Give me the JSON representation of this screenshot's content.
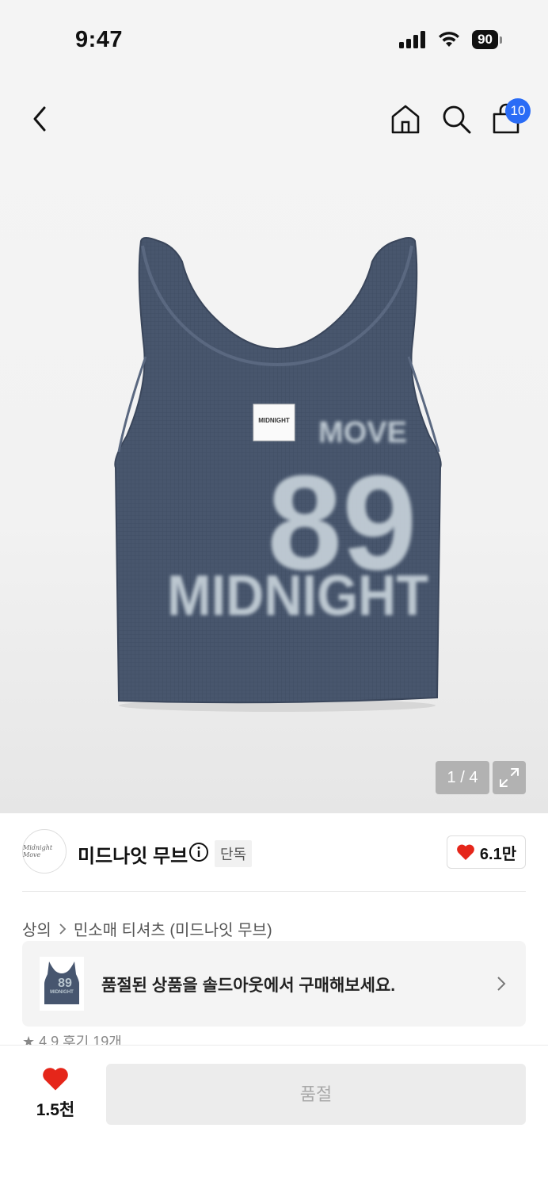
{
  "status": {
    "time": "9:47",
    "battery": "90"
  },
  "nav": {
    "cart_count": "10"
  },
  "product_image": {
    "print_top": "MOVE",
    "print_number": "89",
    "print_brand": "MIDNIGHT",
    "label_tag": "MIDNIGHT",
    "counter": "1 / 4"
  },
  "brand": {
    "logo_text": "Midnight Move",
    "name": "미드나잇 무브",
    "exclusive_badge": "단독",
    "like_count": "6.1만"
  },
  "breadcrumb": {
    "category": "상의",
    "subcategory": "민소매 티셔츠 (미드나잇 무브)"
  },
  "soldout_banner": {
    "text": "품절된 상품을 솔드아웃에서 구매해보세요."
  },
  "partial_row": {
    "text": "★ 4.9 후기 19개"
  },
  "bottom": {
    "like_count": "1.5천",
    "buy_label": "품절"
  },
  "colors": {
    "accent_blue": "#2a6cf6",
    "heart_red": "#e5261a",
    "shirt_navy": "#47566f"
  }
}
